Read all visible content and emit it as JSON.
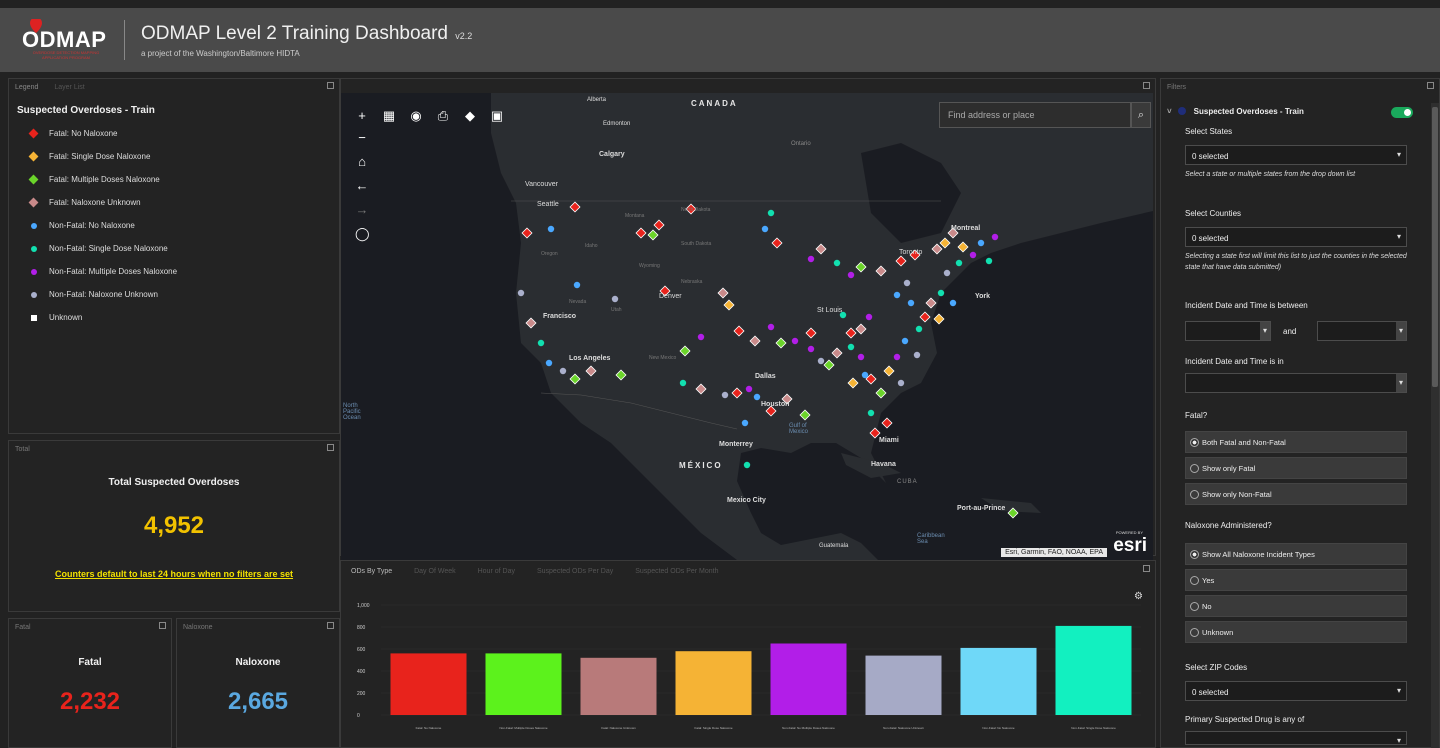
{
  "header": {
    "logo_text": "ODMAP",
    "logo_sub": "OVERDOSE DETECTION MAPPING APPLICATION PROGRAM",
    "title": "ODMAP Level 2 Training Dashboard",
    "version": "v2.2",
    "subtitle": "a project of the Washington/Baltimore HIDTA"
  },
  "legend_panel": {
    "tabs": [
      "Legend",
      "Layer List"
    ],
    "layer_title": "Suspected Overdoses - Train",
    "items": [
      {
        "label": "Fatal: No Naloxone",
        "shape": "diamond",
        "color": "#e8231c"
      },
      {
        "label": "Fatal: Single Dose Naloxone",
        "shape": "diamond",
        "color": "#f5b335"
      },
      {
        "label": "Fatal: Multiple Doses Naloxone",
        "shape": "diamond",
        "color": "#6bd42a"
      },
      {
        "label": "Fatal: Naloxone Unknown",
        "shape": "diamond",
        "color": "#c98a8a"
      },
      {
        "label": "Non-Fatal: No Naloxone",
        "shape": "circle",
        "color": "#4aa8ff"
      },
      {
        "label": "Non-Fatal: Single Dose Naloxone",
        "shape": "circle",
        "color": "#12e0b0"
      },
      {
        "label": "Non-Fatal: Multiple Doses Naloxone",
        "shape": "circle",
        "color": "#b21ee8"
      },
      {
        "label": "Non-Fatal: Naloxone Unknown",
        "shape": "circle",
        "color": "#aab0cc"
      },
      {
        "label": "Unknown",
        "shape": "square",
        "color": "#ffffff"
      }
    ]
  },
  "total_panel": {
    "tab": "Total",
    "heading": "Total Suspected Overdoses",
    "value": "4,952",
    "note": "Counters default to last 24 hours when no filters are set"
  },
  "fatal_panel": {
    "tab": "Fatal",
    "heading": "Fatal",
    "value": "2,232",
    "color": "#e8231c"
  },
  "naloxone_panel": {
    "tab": "Naloxone",
    "heading": "Naloxone",
    "value": "2,665",
    "color": "#5aa8e0"
  },
  "map": {
    "search_placeholder": "Find address or place",
    "attribution": "Esri, Garmin, FAO, NOAA, EPA",
    "powered_by": "POWERED BY",
    "brand": "esri",
    "labels": {
      "canada": "CANADA",
      "mexico": "MÉXICO",
      "alberta": "Alberta",
      "edmonton": "Edmonton",
      "calgary": "Calgary",
      "vancouver": "Vancouver",
      "seattle": "Seattle",
      "ontario": "Ontario",
      "montreal": "Montreal",
      "toronto": "Toronto",
      "york": "York",
      "stlouis": "St Louis",
      "dallas": "Dallas",
      "houston": "Houston",
      "losangeles": "Los Angeles",
      "francisco": "Francisco",
      "monterrey": "Monterrey",
      "mexicocity": "Mexico City",
      "havana": "Havana",
      "cuba": "CUBA",
      "miami": "Miami",
      "portauprince": "Port-au-Prince",
      "guatemala": "Guatemala",
      "gulf": "Gulf of Mexico",
      "pacific": "North Pacific Ocean",
      "caribbean": "Caribbean Sea",
      "northdakota": "North Dakota",
      "southdakota": "South Dakota",
      "nebraska": "Nebraska",
      "wyoming": "Wyoming",
      "oregon": "Oregon",
      "idaho": "Idaho",
      "nevada": "Nevada",
      "utah": "Utah",
      "denver": "Denver",
      "newmexico": "New Mexico",
      "montana": "Montana"
    }
  },
  "chart_panel": {
    "tabs": [
      "ODs By Type",
      "Day Of Week",
      "Hour of Day",
      "Suspected ODs Per Day",
      "Suspected ODs Per Month"
    ]
  },
  "chart_data": {
    "type": "bar",
    "categories": [
      "Fatal: No Naloxone",
      "Non-Fatal: Multiple Doses Naloxone",
      "Fatal: Naloxone Unknown",
      "Fatal: Single Dose Naloxone",
      "Non-Fatal: No Multiple Doses Naloxone",
      "Non-Fatal: Naloxone Unknown",
      "Non-Fatal: No Naloxone",
      "Non-Fatal: Single Dose Naloxone"
    ],
    "values": [
      560,
      560,
      520,
      580,
      650,
      540,
      610,
      810
    ],
    "colors": [
      "#e8231c",
      "#5cf21c",
      "#b87a7a",
      "#f5b335",
      "#b21ee8",
      "#a6aac6",
      "#6fd8f8",
      "#12f0c0"
    ],
    "ylim": [
      0,
      1000
    ],
    "yticks": [
      "0",
      "200",
      "400",
      "600",
      "800",
      "1,000"
    ]
  },
  "filters": {
    "tab": "Filters",
    "layer_name": "Suspected Overdoses - Train",
    "select_states_label": "Select States",
    "select_states_value": "0 selected",
    "select_states_help": "Select a state or multiple states from the drop down list",
    "select_counties_label": "Select Counties",
    "select_counties_value": "0 selected",
    "select_counties_help": "Selecting a state first will limit this list to just the counties in the selected state that have data submitted)",
    "date_between_label": "Incident Date and Time is between",
    "date_and": "and",
    "date_in_label": "Incident Date and Time is in",
    "fatal_label": "Fatal?",
    "fatal_options": [
      "Both Fatal and Non-Fatal",
      "Show only Fatal",
      "Show only Non-Fatal"
    ],
    "naloxone_label": "Naloxone Administered?",
    "naloxone_options": [
      "Show All Naloxone Incident Types",
      "Yes",
      "No",
      "Unknown"
    ],
    "zip_label": "Select ZIP Codes",
    "zip_value": "0 selected",
    "drug_label": "Primary Suspected Drug is any of"
  }
}
